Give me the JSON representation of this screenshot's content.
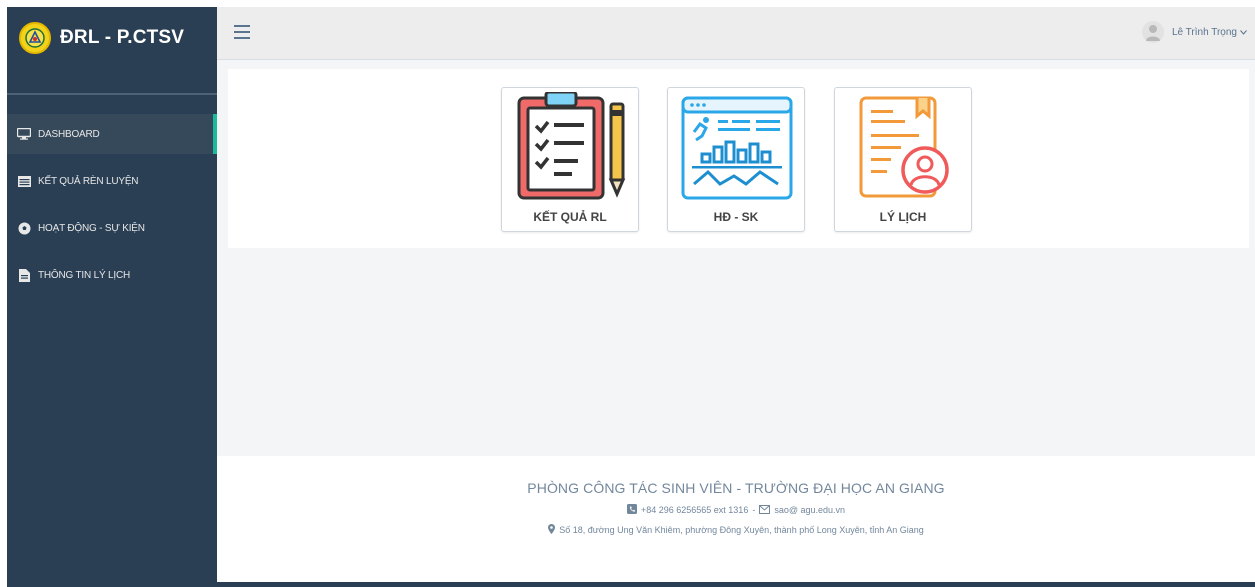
{
  "brand": {
    "title": "ĐRL - P.CTSV",
    "logo_icon": "university-logo-icon"
  },
  "colors": {
    "sidebar": "#2a3f54",
    "active_accent": "#1abb9c",
    "logo_yellow": "#f2d31a",
    "text_muted": "#73879c"
  },
  "sidebar": {
    "items": [
      {
        "label": "DASHBOARD",
        "icon": "desktop-icon",
        "active": true
      },
      {
        "label": "KẾT QUẢ RÈN LUYỆN",
        "icon": "table-icon",
        "active": false
      },
      {
        "label": "HOẠT ĐỘNG - SỰ KIỆN",
        "icon": "soccer-ball-icon",
        "active": false
      },
      {
        "label": "THÔNG TIN LÝ LỊCH",
        "icon": "file-icon",
        "active": false
      }
    ]
  },
  "topbar": {
    "menu_icon": "hamburger-menu-icon",
    "user_name": "Lê Trình Trọng",
    "user_caret": "chevron-down-icon"
  },
  "tiles": [
    {
      "label": "KẾT QUẢ RL",
      "icon": "clipboard-checklist-icon"
    },
    {
      "label": "HĐ - SK",
      "icon": "activity-dashboard-icon"
    },
    {
      "label": "LÝ LỊCH",
      "icon": "profile-document-icon"
    }
  ],
  "footer": {
    "title": "PHÒNG CÔNG TÁC SINH VIÊN - TRƯỜNG ĐẠI HỌC AN GIANG",
    "phone": "+84 296 6256565 ext 1316",
    "separator": "-",
    "email": "sao@ agu.edu.vn",
    "address": "Số 18, đường Ung Văn Khiêm, phường Đông Xuyên, thành phố Long Xuyên, tỉnh An Giang"
  }
}
